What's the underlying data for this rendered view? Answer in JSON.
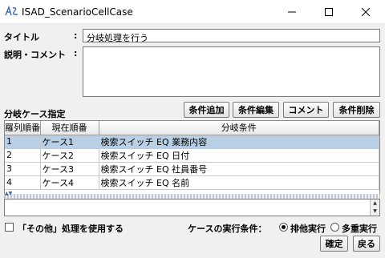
{
  "window": {
    "title": "ISAD_ScenarioCellCase"
  },
  "form": {
    "title_label": "タイトル",
    "title_value": "分岐処理を行う",
    "comment_label": "説明・コメント",
    "comment_value": "",
    "colon": ":"
  },
  "branch": {
    "section_label": "分岐ケース指定",
    "buttons": {
      "add": "条件追加",
      "edit": "条件編集",
      "comment": "コメント",
      "delete": "条件削除"
    },
    "columns": [
      "羅列順番",
      "現在順番",
      "分岐条件"
    ],
    "rows": [
      {
        "order": "1",
        "current": "ケース1",
        "condition": "検索スイッチ EQ 業務内容"
      },
      {
        "order": "2",
        "current": "ケース2",
        "condition": "検索スイッチ EQ 日付"
      },
      {
        "order": "3",
        "current": "ケース3",
        "condition": "検索スイッチ EQ 社員番号"
      },
      {
        "order": "4",
        "current": "ケース4",
        "condition": "検索スイッチ EQ 名前"
      }
    ]
  },
  "options": {
    "use_other_label": "「その他」処理を使用する",
    "exec_condition_label": "ケースの実行条件：",
    "exclusive_label": "排他実行",
    "multi_label": "多重実行",
    "selected": "exclusive"
  },
  "footer": {
    "confirm": "確定",
    "back": "戻る"
  },
  "colors": {
    "selected_row": "#b8cfe5",
    "background": "#f0f0f0"
  }
}
